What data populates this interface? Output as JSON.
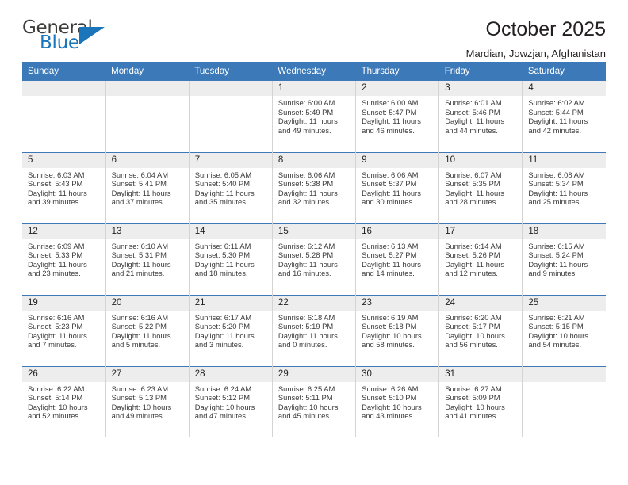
{
  "logo": {
    "word_top": "General",
    "word_bottom": "Blue",
    "triangle_icon": "blue-triangle-icon",
    "accent_color": "#1b75bb"
  },
  "header": {
    "title": "October 2025",
    "subtitle": "Mardian, Jowzjan, Afghanistan",
    "header_bg_color": "#3b79b8",
    "daynum_bg_color": "#ededed"
  },
  "calendar": {
    "weekday_headers": [
      "Sunday",
      "Monday",
      "Tuesday",
      "Wednesday",
      "Thursday",
      "Friday",
      "Saturday"
    ],
    "labels": {
      "sunrise": "Sunrise:",
      "sunset": "Sunset:",
      "daylight": "Daylight:"
    },
    "weeks": [
      [
        {
          "day": "",
          "empty": true
        },
        {
          "day": "",
          "empty": true
        },
        {
          "day": "",
          "empty": true
        },
        {
          "day": "1",
          "sunrise": "Sunrise: 6:00 AM",
          "sunset": "Sunset: 5:49 PM",
          "daylight_1": "Daylight: 11 hours",
          "daylight_2": "and 49 minutes."
        },
        {
          "day": "2",
          "sunrise": "Sunrise: 6:00 AM",
          "sunset": "Sunset: 5:47 PM",
          "daylight_1": "Daylight: 11 hours",
          "daylight_2": "and 46 minutes."
        },
        {
          "day": "3",
          "sunrise": "Sunrise: 6:01 AM",
          "sunset": "Sunset: 5:46 PM",
          "daylight_1": "Daylight: 11 hours",
          "daylight_2": "and 44 minutes."
        },
        {
          "day": "4",
          "sunrise": "Sunrise: 6:02 AM",
          "sunset": "Sunset: 5:44 PM",
          "daylight_1": "Daylight: 11 hours",
          "daylight_2": "and 42 minutes."
        }
      ],
      [
        {
          "day": "5",
          "sunrise": "Sunrise: 6:03 AM",
          "sunset": "Sunset: 5:43 PM",
          "daylight_1": "Daylight: 11 hours",
          "daylight_2": "and 39 minutes."
        },
        {
          "day": "6",
          "sunrise": "Sunrise: 6:04 AM",
          "sunset": "Sunset: 5:41 PM",
          "daylight_1": "Daylight: 11 hours",
          "daylight_2": "and 37 minutes."
        },
        {
          "day": "7",
          "sunrise": "Sunrise: 6:05 AM",
          "sunset": "Sunset: 5:40 PM",
          "daylight_1": "Daylight: 11 hours",
          "daylight_2": "and 35 minutes."
        },
        {
          "day": "8",
          "sunrise": "Sunrise: 6:06 AM",
          "sunset": "Sunset: 5:38 PM",
          "daylight_1": "Daylight: 11 hours",
          "daylight_2": "and 32 minutes."
        },
        {
          "day": "9",
          "sunrise": "Sunrise: 6:06 AM",
          "sunset": "Sunset: 5:37 PM",
          "daylight_1": "Daylight: 11 hours",
          "daylight_2": "and 30 minutes."
        },
        {
          "day": "10",
          "sunrise": "Sunrise: 6:07 AM",
          "sunset": "Sunset: 5:35 PM",
          "daylight_1": "Daylight: 11 hours",
          "daylight_2": "and 28 minutes."
        },
        {
          "day": "11",
          "sunrise": "Sunrise: 6:08 AM",
          "sunset": "Sunset: 5:34 PM",
          "daylight_1": "Daylight: 11 hours",
          "daylight_2": "and 25 minutes."
        }
      ],
      [
        {
          "day": "12",
          "sunrise": "Sunrise: 6:09 AM",
          "sunset": "Sunset: 5:33 PM",
          "daylight_1": "Daylight: 11 hours",
          "daylight_2": "and 23 minutes."
        },
        {
          "day": "13",
          "sunrise": "Sunrise: 6:10 AM",
          "sunset": "Sunset: 5:31 PM",
          "daylight_1": "Daylight: 11 hours",
          "daylight_2": "and 21 minutes."
        },
        {
          "day": "14",
          "sunrise": "Sunrise: 6:11 AM",
          "sunset": "Sunset: 5:30 PM",
          "daylight_1": "Daylight: 11 hours",
          "daylight_2": "and 18 minutes."
        },
        {
          "day": "15",
          "sunrise": "Sunrise: 6:12 AM",
          "sunset": "Sunset: 5:28 PM",
          "daylight_1": "Daylight: 11 hours",
          "daylight_2": "and 16 minutes."
        },
        {
          "day": "16",
          "sunrise": "Sunrise: 6:13 AM",
          "sunset": "Sunset: 5:27 PM",
          "daylight_1": "Daylight: 11 hours",
          "daylight_2": "and 14 minutes."
        },
        {
          "day": "17",
          "sunrise": "Sunrise: 6:14 AM",
          "sunset": "Sunset: 5:26 PM",
          "daylight_1": "Daylight: 11 hours",
          "daylight_2": "and 12 minutes."
        },
        {
          "day": "18",
          "sunrise": "Sunrise: 6:15 AM",
          "sunset": "Sunset: 5:24 PM",
          "daylight_1": "Daylight: 11 hours",
          "daylight_2": "and 9 minutes."
        }
      ],
      [
        {
          "day": "19",
          "sunrise": "Sunrise: 6:16 AM",
          "sunset": "Sunset: 5:23 PM",
          "daylight_1": "Daylight: 11 hours",
          "daylight_2": "and 7 minutes."
        },
        {
          "day": "20",
          "sunrise": "Sunrise: 6:16 AM",
          "sunset": "Sunset: 5:22 PM",
          "daylight_1": "Daylight: 11 hours",
          "daylight_2": "and 5 minutes."
        },
        {
          "day": "21",
          "sunrise": "Sunrise: 6:17 AM",
          "sunset": "Sunset: 5:20 PM",
          "daylight_1": "Daylight: 11 hours",
          "daylight_2": "and 3 minutes."
        },
        {
          "day": "22",
          "sunrise": "Sunrise: 6:18 AM",
          "sunset": "Sunset: 5:19 PM",
          "daylight_1": "Daylight: 11 hours",
          "daylight_2": "and 0 minutes."
        },
        {
          "day": "23",
          "sunrise": "Sunrise: 6:19 AM",
          "sunset": "Sunset: 5:18 PM",
          "daylight_1": "Daylight: 10 hours",
          "daylight_2": "and 58 minutes."
        },
        {
          "day": "24",
          "sunrise": "Sunrise: 6:20 AM",
          "sunset": "Sunset: 5:17 PM",
          "daylight_1": "Daylight: 10 hours",
          "daylight_2": "and 56 minutes."
        },
        {
          "day": "25",
          "sunrise": "Sunrise: 6:21 AM",
          "sunset": "Sunset: 5:15 PM",
          "daylight_1": "Daylight: 10 hours",
          "daylight_2": "and 54 minutes."
        }
      ],
      [
        {
          "day": "26",
          "sunrise": "Sunrise: 6:22 AM",
          "sunset": "Sunset: 5:14 PM",
          "daylight_1": "Daylight: 10 hours",
          "daylight_2": "and 52 minutes."
        },
        {
          "day": "27",
          "sunrise": "Sunrise: 6:23 AM",
          "sunset": "Sunset: 5:13 PM",
          "daylight_1": "Daylight: 10 hours",
          "daylight_2": "and 49 minutes."
        },
        {
          "day": "28",
          "sunrise": "Sunrise: 6:24 AM",
          "sunset": "Sunset: 5:12 PM",
          "daylight_1": "Daylight: 10 hours",
          "daylight_2": "and 47 minutes."
        },
        {
          "day": "29",
          "sunrise": "Sunrise: 6:25 AM",
          "sunset": "Sunset: 5:11 PM",
          "daylight_1": "Daylight: 10 hours",
          "daylight_2": "and 45 minutes."
        },
        {
          "day": "30",
          "sunrise": "Sunrise: 6:26 AM",
          "sunset": "Sunset: 5:10 PM",
          "daylight_1": "Daylight: 10 hours",
          "daylight_2": "and 43 minutes."
        },
        {
          "day": "31",
          "sunrise": "Sunrise: 6:27 AM",
          "sunset": "Sunset: 5:09 PM",
          "daylight_1": "Daylight: 10 hours",
          "daylight_2": "and 41 minutes."
        },
        {
          "day": "",
          "empty": true
        }
      ]
    ]
  }
}
